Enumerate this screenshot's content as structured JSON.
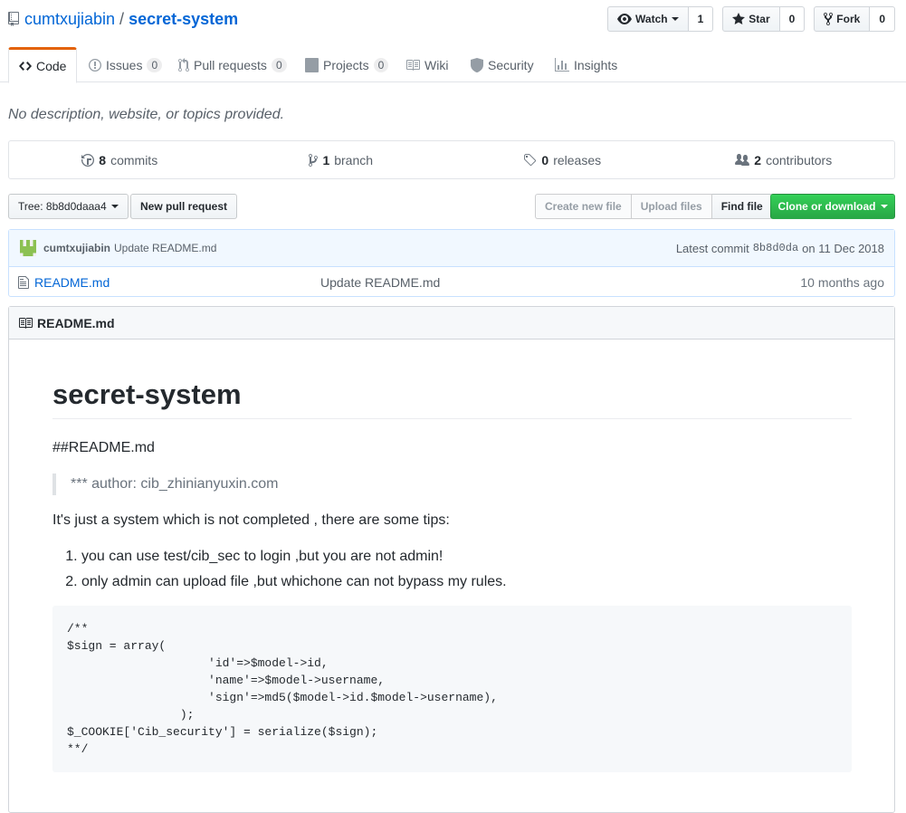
{
  "repo": {
    "owner": "cumtxujiabin",
    "separator": "/",
    "name": "secret-system"
  },
  "actions": [
    {
      "label": "Watch",
      "count": "1",
      "icon": "eye-icon"
    },
    {
      "label": "Star",
      "count": "0",
      "icon": "star-icon"
    },
    {
      "label": "Fork",
      "count": "0",
      "icon": "fork-icon"
    }
  ],
  "tabs": [
    {
      "label": "Code",
      "icon": "code-icon",
      "selected": true
    },
    {
      "label": "Issues",
      "count": "0",
      "icon": "issue-icon"
    },
    {
      "label": "Pull requests",
      "count": "0",
      "icon": "pull-request-icon"
    },
    {
      "label": "Projects",
      "count": "0",
      "icon": "project-icon"
    },
    {
      "label": "Wiki",
      "icon": "book-icon"
    },
    {
      "label": "Security",
      "icon": "shield-icon"
    },
    {
      "label": "Insights",
      "icon": "graph-icon"
    }
  ],
  "description": "No description, website, or topics provided.",
  "summary": {
    "commits": {
      "num": "8",
      "label": "commits"
    },
    "branch": {
      "num": "1",
      "label": "branch"
    },
    "releases": {
      "num": "0",
      "label": "releases"
    },
    "contributors": {
      "num": "2",
      "label": "contributors"
    }
  },
  "file_nav": {
    "tree_label": "Tree: 8b8d0daaa4",
    "new_pr": "New pull request",
    "create_file": "Create new file",
    "upload_files": "Upload files",
    "find_file": "Find file",
    "clone": "Clone or download"
  },
  "commit": {
    "author": "cumtxujiabin",
    "message": "Update README.md",
    "latest_label": "Latest commit",
    "sha": "8b8d0da",
    "date": "on 11 Dec 2018"
  },
  "files": [
    {
      "name": "README.md",
      "message": "Update README.md",
      "age": "10 months ago"
    }
  ],
  "readme": {
    "header": "README.md",
    "title": "secret-system",
    "p1": "##README.md",
    "quote": "*** author: cib_zhinianyuxin.com",
    "p2": "It's just a system which is not completed , there are some tips:",
    "list": [
      "you can use test/cib_sec to login ,but you are not admin!",
      "only admin can upload file ,but whichone can not bypass my rules."
    ],
    "code": "/**\n$sign = array(\n                    'id'=>$model->id,\n                    'name'=>$model->username,\n                    'sign'=>md5($model->id.$model->username),\n                );\n$_COOKIE['Cib_security'] = serialize($sign);\n**/"
  },
  "colors": {
    "link": "#0366d6",
    "tab_accent": "#e36209",
    "clone_green": "#28a745",
    "commit_bg": "#f1f8ff"
  }
}
